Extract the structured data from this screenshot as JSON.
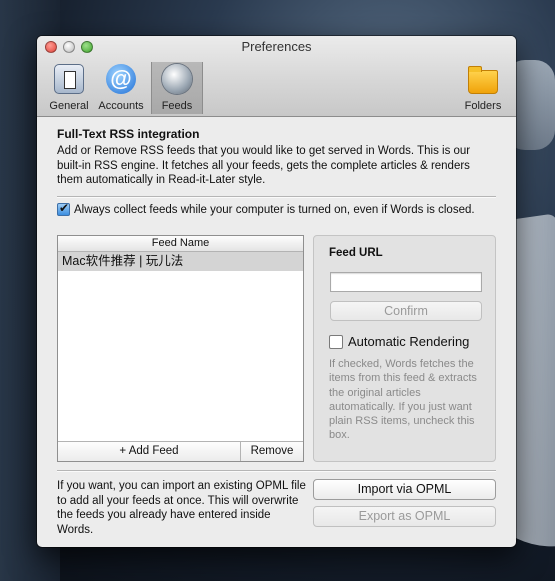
{
  "window": {
    "title": "Preferences"
  },
  "toolbar": {
    "items": [
      {
        "label": "General",
        "icon": "general-switch-icon"
      },
      {
        "label": "Accounts",
        "icon": "at-sign-icon"
      },
      {
        "label": "Feeds",
        "icon": "feeds-globe-icon",
        "selected": true
      },
      {
        "label": "Folders",
        "icon": "folder-icon"
      }
    ]
  },
  "feeds": {
    "heading": "Full-Text RSS integration",
    "description": "Add or Remove RSS feeds that you would like to get served in Words. This is our built-in RSS engine. It fetches all your feeds, gets the complete articles & renders them automatically in Read-it-Later style.",
    "always_collect_label": "Always collect feeds while your computer is turned on, even if Words is closed.",
    "always_collect_checked": true,
    "list": {
      "header": "Feed Name",
      "rows": [
        "Mac软件推荐 | 玩儿法"
      ],
      "add_label": "+ Add Feed",
      "remove_label": "Remove"
    },
    "panel": {
      "url_label": "Feed URL",
      "url_value": "",
      "confirm_label": "Confirm",
      "auto_render_label": "Automatic Rendering",
      "auto_render_checked": false,
      "help": "If checked, Words fetches the items from this feed & extracts the original articles automatically. If you just want plain RSS items, uncheck this box."
    },
    "opml": {
      "text": "If you want, you can import an existing OPML file to add all your feeds at once. This will overwrite the feeds you already have entered inside Words.",
      "import_label": "Import via OPML",
      "export_label": "Export as OPML"
    }
  },
  "colors": {
    "selection": "#d4d4d4",
    "accent": "#3b8ee0"
  }
}
